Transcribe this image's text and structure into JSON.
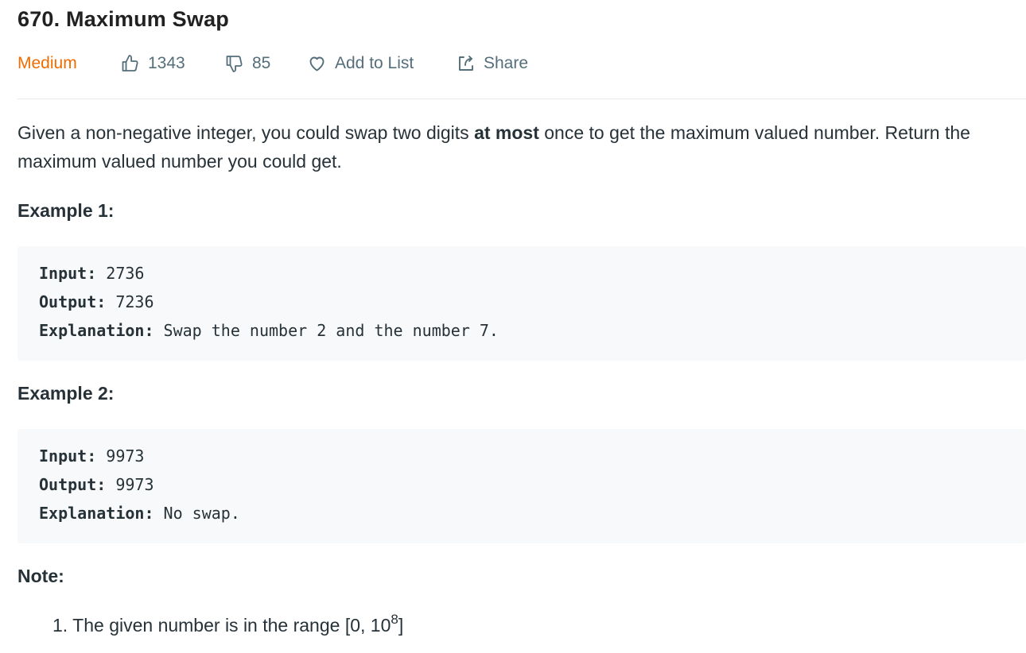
{
  "problem": {
    "title": "670. Maximum Swap",
    "difficulty": "Medium",
    "likes": "1343",
    "dislikes": "85",
    "add_to_list_label": "Add to List",
    "share_label": "Share"
  },
  "description": {
    "before_bold": "Given a non-negative integer, you could swap two digits ",
    "bold": "at most",
    "after_bold": " once to get the maximum valued number. Return the maximum valued number you could get."
  },
  "examples": [
    {
      "heading": "Example 1:",
      "input_key": "Input:",
      "input_value": " 2736",
      "output_key": "Output:",
      "output_value": " 7236",
      "explanation_key": "Explanation:",
      "explanation_value": " Swap the number 2 and the number 7."
    },
    {
      "heading": "Example 2:",
      "input_key": "Input:",
      "input_value": " 9973",
      "output_key": "Output:",
      "output_value": " 9973",
      "explanation_key": "Explanation:",
      "explanation_value": " No swap."
    }
  ],
  "note": {
    "heading": "Note:",
    "items": [
      {
        "number": "1.",
        "text": "The given number is in the range [0, 10",
        "sup": "8",
        "suffix": "]"
      }
    ]
  },
  "colors": {
    "difficulty_medium": "#ef6c00",
    "meta_text": "#546e7a",
    "code_background": "#f7f9fa",
    "body_text": "#263238"
  },
  "icons": {
    "like": "thumbs-up-icon",
    "dislike": "thumbs-down-icon",
    "add_to_list": "heart-icon",
    "share": "share-icon"
  }
}
